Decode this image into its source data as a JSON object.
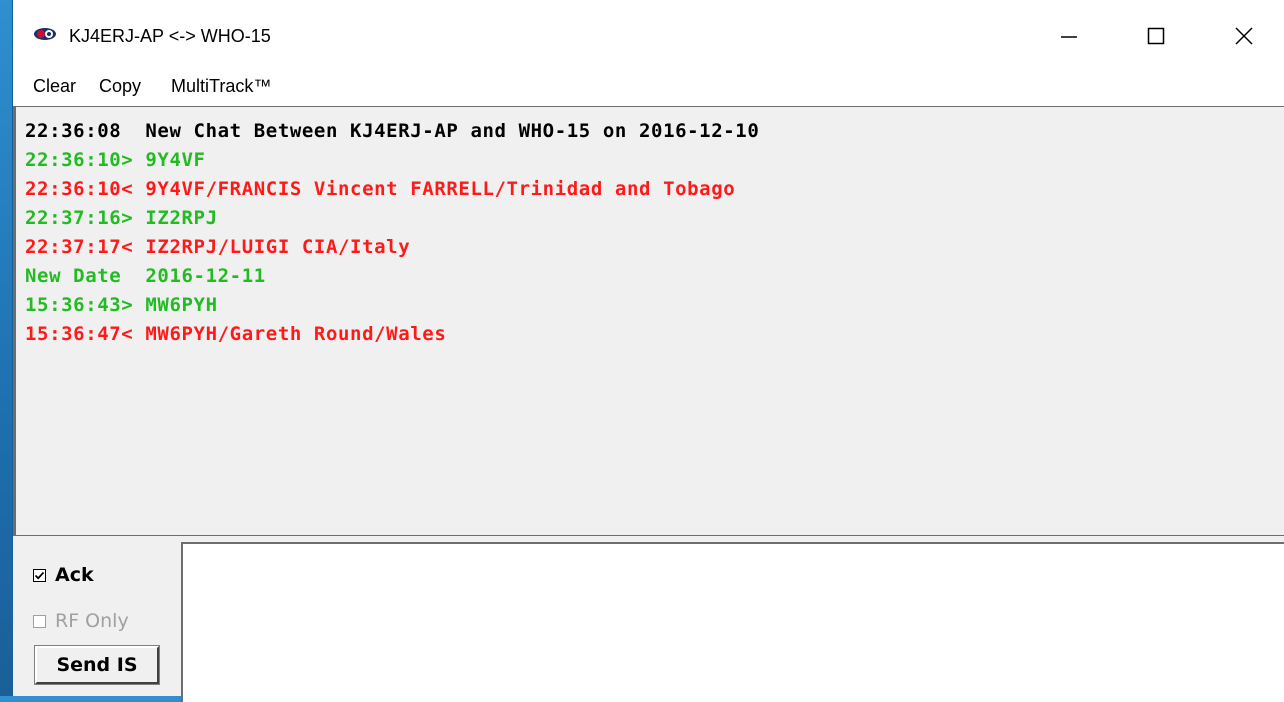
{
  "window": {
    "title": "KJ4ERJ-AP <-> WHO-15",
    "controls": {
      "minimize_icon": "minimize-icon",
      "maximize_icon": "maximize-icon",
      "close_icon": "close-icon"
    }
  },
  "menu": {
    "items": [
      {
        "label": "Clear"
      },
      {
        "label": "Copy"
      },
      {
        "label": "MultiTrack™"
      }
    ]
  },
  "log": {
    "lines": [
      {
        "text": "22:36:08  New Chat Between KJ4ERJ-AP and WHO-15 on 2016-12-10",
        "color": "#000000"
      },
      {
        "text": "22:36:10> 9Y4VF",
        "color": "#22bb22"
      },
      {
        "text": "22:36:10< 9Y4VF/FRANCIS Vincent FARRELL/Trinidad and Tobago",
        "color": "#ff1a1a"
      },
      {
        "text": "22:37:16> IZ2RPJ",
        "color": "#22bb22"
      },
      {
        "text": "22:37:17< IZ2RPJ/LUIGI CIA/Italy",
        "color": "#ff1a1a"
      },
      {
        "text": "New Date  2016-12-11",
        "color": "#22bb22"
      },
      {
        "text": "15:36:43> MW6PYH",
        "color": "#22bb22"
      },
      {
        "text": "15:36:47< MW6PYH/Gareth Round/Wales",
        "color": "#ff1a1a"
      }
    ]
  },
  "controls": {
    "ack_label": "Ack",
    "ack_checked": true,
    "rf_only_label": "RF Only",
    "rf_only_checked": false,
    "send_button_label": "Send IS",
    "message_input_value": ""
  }
}
